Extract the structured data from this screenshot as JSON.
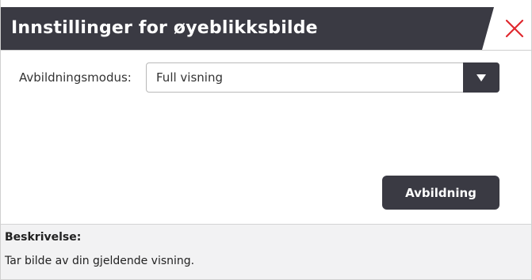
{
  "dialog": {
    "title": "Innstillinger for øyeblikksbilde",
    "close_icon": "close-icon"
  },
  "form": {
    "mode_label": "Avbildningsmodus:",
    "mode_value": "Full visning",
    "dropdown_icon": "caret-down-icon"
  },
  "actions": {
    "capture_label": "Avbildning"
  },
  "description": {
    "heading": "Beskrivelse:",
    "text": "Tar bilde av din gjeldende visning."
  },
  "colors": {
    "title_bar": "#3a3a43",
    "close_accent": "#e0282e",
    "button": "#3a3a43",
    "description_bg": "#f2f2f3"
  }
}
